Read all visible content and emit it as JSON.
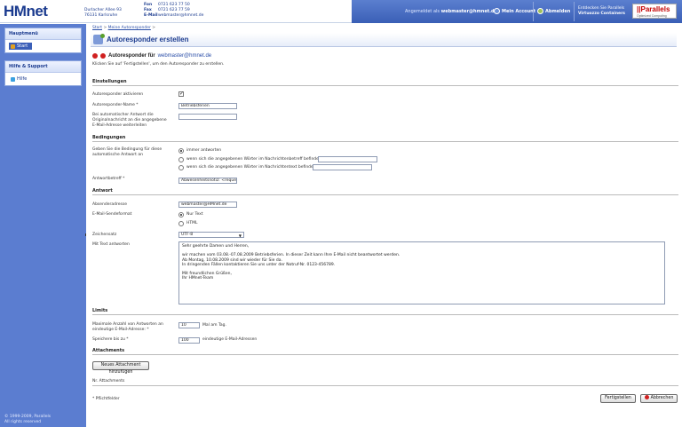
{
  "header": {
    "logo": "HMnet",
    "address_line1": "Durlacher Allee 93",
    "address_line2": "76131 Karlsruhe",
    "fon_label": "Fon",
    "fon_value": "0721 623 77 50",
    "fax_label": "Fax",
    "fax_value": "0721 623 77 59",
    "email_label": "E-Mail",
    "email_value": "webmaster@hmnet.de",
    "logged_in_prefix": "Angemeldet als",
    "logged_in_user": "webmaster@hmnet.de",
    "my_account": "Mein Account",
    "logout": "Abmelden",
    "discover_line1": "Entdecken Sie Parallels",
    "discover_line2": "Virtuozzo Containers",
    "parallels_logo": "||Parallels",
    "parallels_sub": "Optimized Computing"
  },
  "sidebar": {
    "main_menu_title": "Hauptmenü",
    "start_label": "Start",
    "help_title": "Hilfe & Support",
    "help_label": "Hilfe",
    "copyright1": "© 1999-2009, Parallels",
    "copyright2": "All rights reserved"
  },
  "breadcrumb": {
    "start": "Start",
    "sep": ">",
    "mine": "Meine Autoresponder",
    "sep2": ">"
  },
  "page": {
    "title": "Autoresponder erstellen",
    "subhead_prefix": "Autoresponder für",
    "subhead_email": "webmaster@hmnet.de",
    "hint": "Klicken Sie auf 'Fertigstellen', um den Autoresponder zu erstellen."
  },
  "settings": {
    "section": "Einstellungen",
    "activate_label": "Autoresponder aktivieren",
    "activate_checked": true,
    "name_label": "Autoresponder-Name *",
    "name_value": "Betriebsferien",
    "forward_label_1": "Bei automatischer Antwort die",
    "forward_label_2": "Originalnachricht an die angegebene",
    "forward_label_3": "E-Mail-Adresse weiterleiten",
    "forward_value": ""
  },
  "conditions": {
    "section": "Bedingungen",
    "label_1": "Geben Sie die Bedingung für diese",
    "label_2": "automatische Antwort an",
    "opt_always": "immer antworten",
    "opt_subject": "wenn sich die angegebenen Wörter im Nachrichtenbetreff befinden",
    "opt_body": "wenn sich die angegebenen Wörter im Nachrichtentext befinden",
    "selected": "always",
    "reply_subject_label": "Antwortbetreff *",
    "reply_subject_value": "Abwesenheitsnotiz: <reques"
  },
  "answer": {
    "section": "Antwort",
    "sender_label": "Absenderadresse",
    "sender_value": "webmaster@HMnet.de",
    "format_label": "E-Mail-Sendeformat",
    "format_plain": "Nur Text",
    "format_html": "HTML",
    "format_selected": "plain",
    "charset_label": "Zeichensatz",
    "charset_value": "UTF-8",
    "text_label": "Mit Text antworten",
    "text_lines": [
      "Sehr geehrte Damen und Herren,",
      "",
      "wir machen vom 03.08.-07.08.2009 Betriebsferien. In dieser Zeit kann Ihre E-Mail nicht beantwortet werden.",
      "Ab Montag, 10.08.2009 sind wir wieder für Sie da.",
      "In dringenden Fällen kontaktieren Sie uns unter der Notruf-Nr. 0123-456789.",
      "",
      "Mit freundlichen Grüßen,",
      "Ihr HMnet-Team"
    ]
  },
  "limits": {
    "section": "Limits",
    "max_label_1": "Maximale Anzahl von Antworten an",
    "max_label_2": "eindeutige E-Mail-Adresse: *",
    "max_value": "10",
    "max_suffix": "Mal am Tag.",
    "store_label": "Speichere bis zu *",
    "store_value": "100",
    "store_suffix": "eindeutige E-Mail-Adressen"
  },
  "attachments": {
    "section": "Attachments",
    "new_button": "Neues Attachment hinzufügen",
    "list_header": "Nr.  Attachments"
  },
  "footer": {
    "required_note": "* Pflichtfelder",
    "finish_button": "Fertigstellen",
    "cancel_button": "Abbrechen"
  }
}
